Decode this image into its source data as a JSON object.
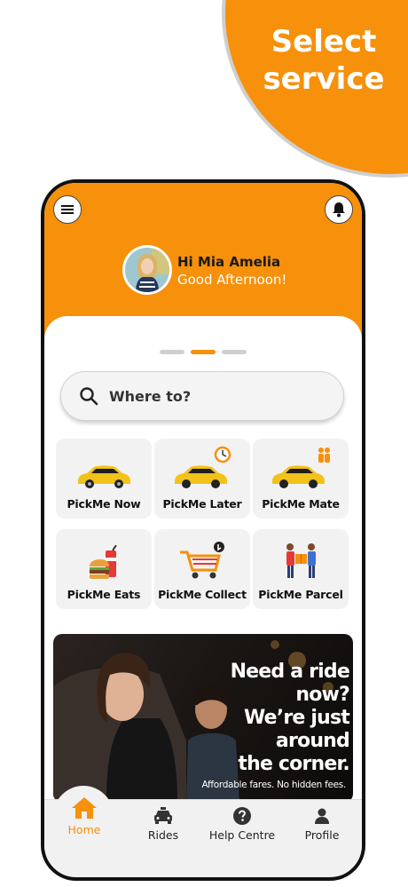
{
  "promo": {
    "line1": "Select",
    "line2": "service"
  },
  "header": {
    "greeting_name": "Hi Mia Amelia",
    "greeting_sub": "Good Afternoon!",
    "accent_color": "#f7900a"
  },
  "icons": {
    "menu": "menu-icon",
    "bell": "bell-icon",
    "search": "search-icon"
  },
  "pager": {
    "pages": 3,
    "active": 2
  },
  "search": {
    "placeholder": "Where to?"
  },
  "services": [
    {
      "label": "PickMe Now",
      "icon": "car-icon"
    },
    {
      "label": "PickMe Later",
      "icon": "car-clock-icon"
    },
    {
      "label": "PickMe Mate",
      "icon": "car-people-icon"
    },
    {
      "label": "PickMe Eats",
      "icon": "food-icon"
    },
    {
      "label": "PickMe Collect",
      "icon": "cart-icon"
    },
    {
      "label": "PickMe Parcel",
      "icon": "parcel-icon"
    }
  ],
  "banner": {
    "headline_1": "Need a ride",
    "headline_2": "now?",
    "headline_3": "We’re just",
    "headline_4": "around",
    "headline_5": "the corner.",
    "subline": "Affordable fares. No hidden fees."
  },
  "nav": [
    {
      "label": "Home",
      "icon": "home-icon",
      "active": true
    },
    {
      "label": "Rides",
      "icon": "taxi-icon",
      "active": false
    },
    {
      "label": "Help Centre",
      "icon": "help-icon",
      "active": false
    },
    {
      "label": "Profile",
      "icon": "profile-icon",
      "active": false
    }
  ]
}
